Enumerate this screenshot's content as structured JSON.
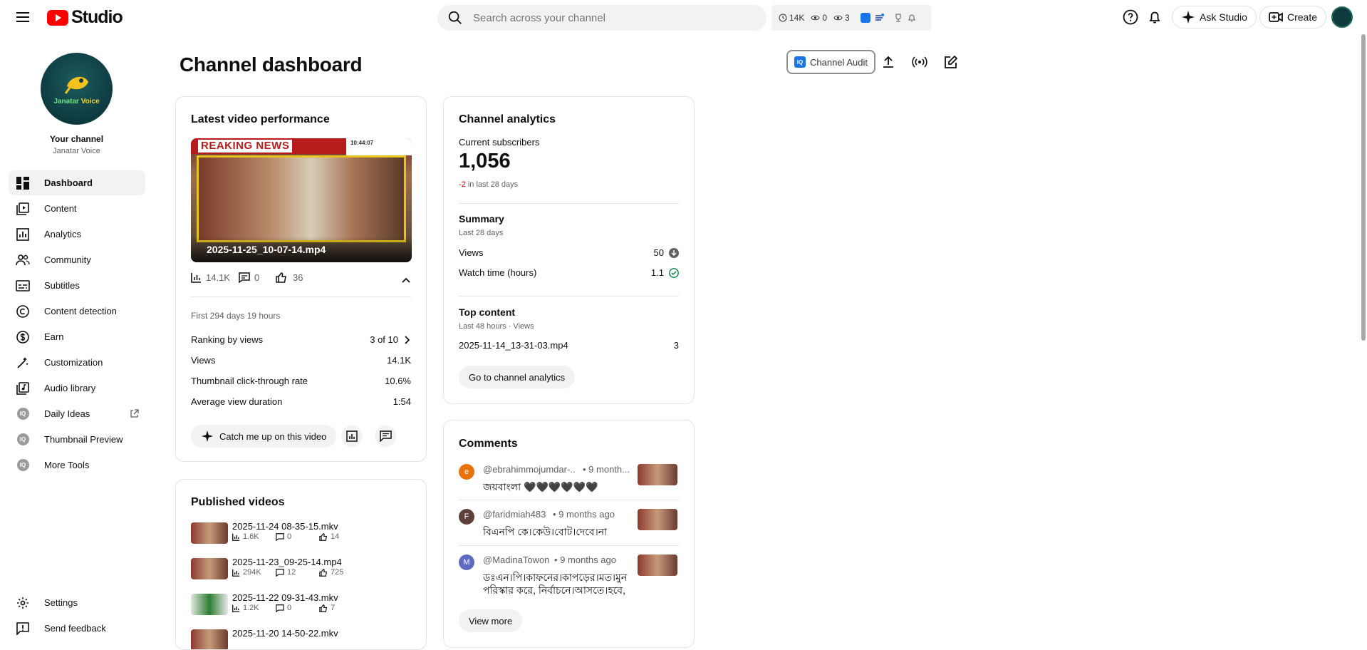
{
  "header": {
    "logo_text": "Studio",
    "search_placeholder": "Search across your channel",
    "ext_stats": {
      "watch": "14K",
      "views": "0",
      "subs": "3"
    },
    "ask_studio": "Ask Studio",
    "create": "Create"
  },
  "sidebar": {
    "channel_brand_a": "Janatar",
    "channel_brand_b": "Voice",
    "your_channel": "Your channel",
    "channel_name": "Janatar Voice",
    "items": [
      {
        "label": "Dashboard",
        "icon": "dashboard-icon"
      },
      {
        "label": "Content",
        "icon": "content-icon"
      },
      {
        "label": "Analytics",
        "icon": "analytics-icon"
      },
      {
        "label": "Community",
        "icon": "community-icon"
      },
      {
        "label": "Subtitles",
        "icon": "subtitles-icon"
      },
      {
        "label": "Content detection",
        "icon": "copyright-icon"
      },
      {
        "label": "Earn",
        "icon": "dollar-icon"
      },
      {
        "label": "Customization",
        "icon": "magic-wand-icon"
      },
      {
        "label": "Audio library",
        "icon": "audio-library-icon"
      },
      {
        "label": "Daily Ideas",
        "icon": "extension-icon"
      },
      {
        "label": "Thumbnail Preview",
        "icon": "extension-icon"
      },
      {
        "label": "More Tools",
        "icon": "extension-icon"
      }
    ],
    "ext_badge": "IQ",
    "settings": "Settings",
    "feedback": "Send feedback"
  },
  "main": {
    "title": "Channel dashboard",
    "audit_badge": "IQ",
    "audit_label": "Channel Audit"
  },
  "latest_video": {
    "title": "Latest video performance",
    "banner": "REAKING NEWS",
    "clock": "10:44:07",
    "video_name": "2025-11-25_10-07-14.mp4",
    "views": "14.1K",
    "comments": "0",
    "likes": "36",
    "period": "First 294 days 19 hours",
    "rows": [
      {
        "label": "Ranking by views",
        "value": "3 of 10"
      },
      {
        "label": "Views",
        "value": "14.1K"
      },
      {
        "label": "Thumbnail click-through rate",
        "value": "10.6%"
      },
      {
        "label": "Average view duration",
        "value": "1:54"
      }
    ],
    "catch_up": "Catch me up on this video"
  },
  "analytics": {
    "title": "Channel analytics",
    "subs_label": "Current subscribers",
    "subs_value": "1,056",
    "subs_change": "-2",
    "subs_change_suffix": "in last 28 days",
    "summary_title": "Summary",
    "summary_period": "Last 28 days",
    "views_label": "Views",
    "views_value": "50",
    "watch_label": "Watch time (hours)",
    "watch_value": "1.1",
    "top_title": "Top content",
    "top_period": "Last 48 hours · Views",
    "top_item": "2025-11-14_13-31-03.mp4",
    "top_value": "3",
    "go_button": "Go to channel analytics"
  },
  "published": {
    "title": "Published videos",
    "videos": [
      {
        "name": "2025-11-24 08-35-15.mkv",
        "views": "1.6K",
        "comments": "0",
        "likes": "14"
      },
      {
        "name": "2025-11-23_09-25-14.mp4",
        "views": "294K",
        "comments": "12",
        "likes": "725"
      },
      {
        "name": "2025-11-22 09-31-43.mkv",
        "views": "1.2K",
        "comments": "0",
        "likes": "7"
      },
      {
        "name": "2025-11-20 14-50-22.mkv",
        "views": "",
        "comments": "",
        "likes": ""
      }
    ]
  },
  "comments": {
    "title": "Comments",
    "items": [
      {
        "initial": "e",
        "color": "#e8710a",
        "author": "@ebrahimmojumdar-...",
        "time": "• 9 month...",
        "text": "জয়বাংলা 🖤🖤🖤🖤🖤🖤"
      },
      {
        "initial": "F",
        "color": "#5d4037",
        "author": "@faridmiah483",
        "time": "• 9 months ago",
        "text": "বিএনপি কে।কেউ।বোট।দেবে।না"
      },
      {
        "initial": "M",
        "color": "#5c6bc0",
        "author": "@MadinaTowon",
        "time": "• 9 months ago",
        "text": "ডঃএন।পি।কাফনের।কাপড়ের।মত।মুন",
        "text2": "পরিস্কার করে, নির্বাচনে।আসতে।হবে, ..."
      }
    ],
    "view_more": "View more"
  }
}
